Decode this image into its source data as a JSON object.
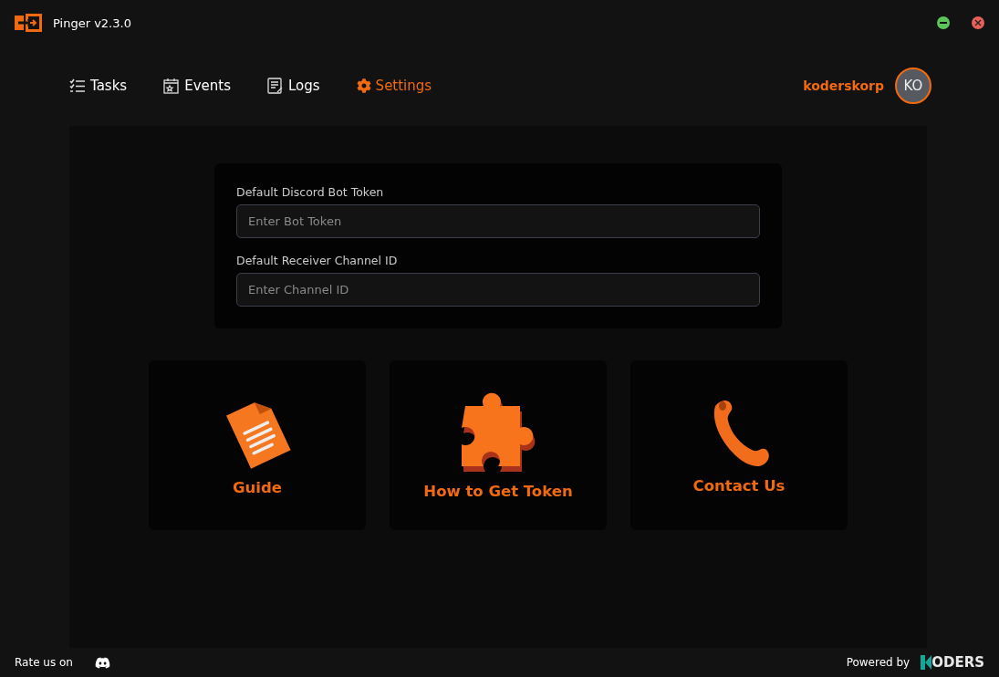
{
  "window": {
    "title": "Pinger v2.3.0"
  },
  "nav": [
    {
      "label": "Tasks",
      "kind": "tasks",
      "selected": false
    },
    {
      "label": "Events",
      "kind": "events",
      "selected": false
    },
    {
      "label": "Logs",
      "kind": "logs",
      "selected": false
    },
    {
      "label": "Settings",
      "kind": "settings",
      "selected": true
    }
  ],
  "user": {
    "name": "koderskorp",
    "initials": "KO"
  },
  "form": {
    "fields": [
      {
        "label": "Default Discord Bot Token",
        "placeholder": "Enter Bot Token"
      },
      {
        "label": "Default Receiver Channel ID",
        "placeholder": "Enter Channel ID"
      }
    ]
  },
  "cards": [
    {
      "label": "Guide",
      "kind": "document"
    },
    {
      "label": "How to Get Token",
      "kind": "puzzle"
    },
    {
      "label": "Contact Us",
      "kind": "phone"
    }
  ],
  "footer": {
    "rate": "Rate us on",
    "powered": "Powered by",
    "brand": "ODERS"
  }
}
